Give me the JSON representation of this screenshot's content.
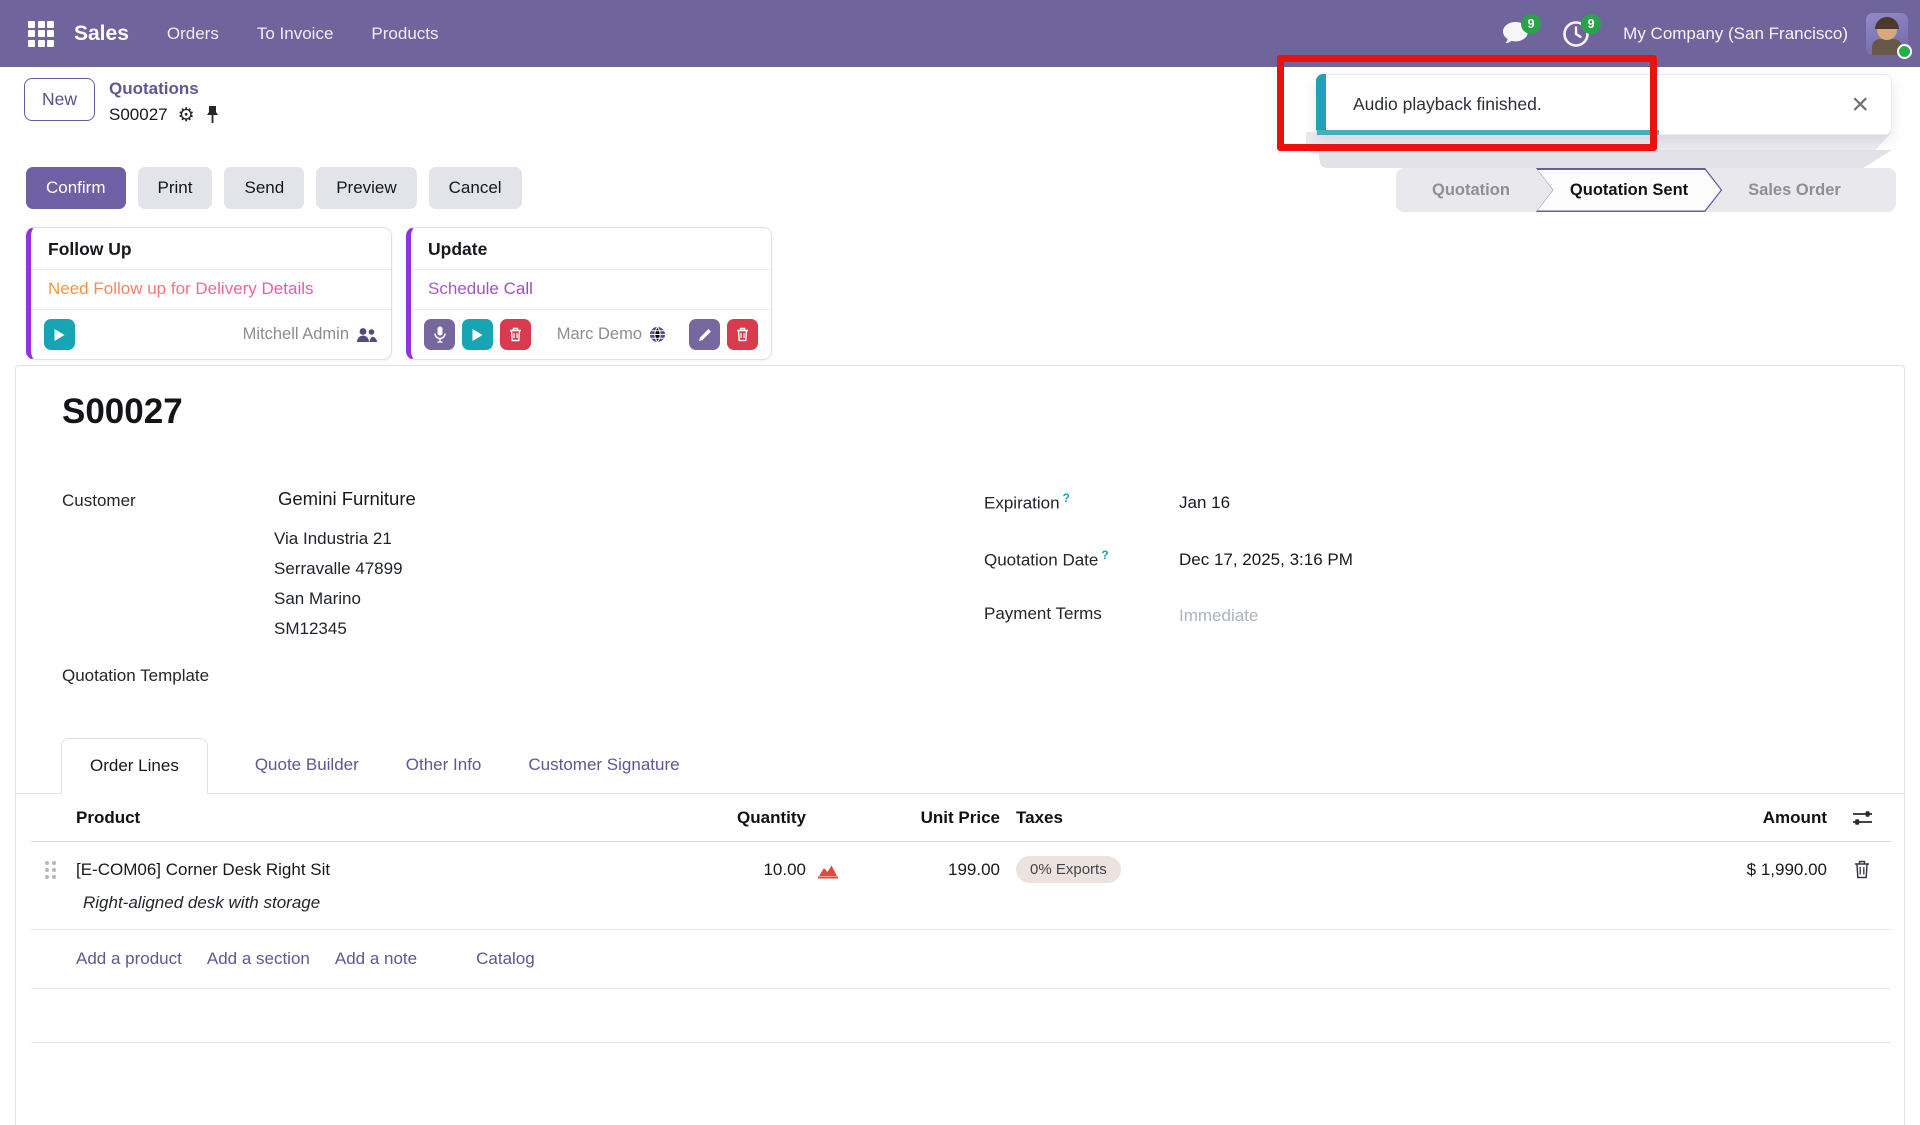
{
  "nav": {
    "app_name": "Sales",
    "items": [
      {
        "label": "Orders"
      },
      {
        "label": "To Invoice"
      },
      {
        "label": "Products"
      }
    ],
    "messages_badge": "9",
    "activities_badge": "9",
    "company": "My Company (San Francisco)"
  },
  "breadcrumb": {
    "new_button": "New",
    "parent": "Quotations",
    "current": "S00027",
    "gear_glyph": "⚙"
  },
  "toast": {
    "message": "Audio playback finished.",
    "close_glyph": "×"
  },
  "actions": {
    "confirm": "Confirm",
    "print": "Print",
    "send": "Send",
    "preview": "Preview",
    "cancel": "Cancel"
  },
  "statusbar": {
    "steps": [
      {
        "label": "Quotation"
      },
      {
        "label": "Quotation Sent"
      },
      {
        "label": "Sales Order"
      }
    ]
  },
  "activities": {
    "followup": {
      "title": "Follow Up",
      "summary": "Need Follow up for Delivery Details",
      "assignee": "Mitchell Admin"
    },
    "update": {
      "title": "Update",
      "summary": "Schedule Call",
      "assignee": "Marc Demo"
    }
  },
  "order": {
    "number": "S00027",
    "customer_label": "Customer",
    "customer_name": "Gemini Furniture",
    "address_lines": [
      "Via Industria 21",
      "Serravalle 47899",
      "San Marino",
      "SM12345"
    ],
    "expiration_label": "Expiration",
    "expiration_value": "Jan 16",
    "quotation_date_label": "Quotation Date",
    "quotation_date_value": "Dec 17, 2025, 3:16 PM",
    "payment_terms_label": "Payment Terms",
    "payment_terms_placeholder": "Immediate",
    "template_label": "Quotation Template"
  },
  "tabs": [
    {
      "label": "Order Lines"
    },
    {
      "label": "Quote Builder"
    },
    {
      "label": "Other Info"
    },
    {
      "label": "Customer Signature"
    }
  ],
  "table": {
    "headers": {
      "product": "Product",
      "quantity": "Quantity",
      "unit_price": "Unit Price",
      "taxes": "Taxes",
      "amount": "Amount"
    },
    "rows": [
      {
        "product": "[E-COM06] Corner Desk Right Sit",
        "description": "Right-aligned desk with storage",
        "quantity": "10.00",
        "unit_price": "199.00",
        "taxes": "0% Exports",
        "amount": "$ 1,990.00"
      }
    ],
    "footer_links": [
      {
        "label": "Add a product"
      },
      {
        "label": "Add a section"
      },
      {
        "label": "Add a note"
      },
      {
        "label": "Catalog"
      }
    ]
  },
  "colors": {
    "nav_purple": "#6f649c",
    "accent_purple": "#6f5fa5",
    "link_purple": "#5f5695",
    "card_accent": "#9031e2",
    "teal": "#17a5b3",
    "danger_red": "#da3a4e",
    "badge_green": "#27a348",
    "annotation_red": "#ea120c"
  }
}
